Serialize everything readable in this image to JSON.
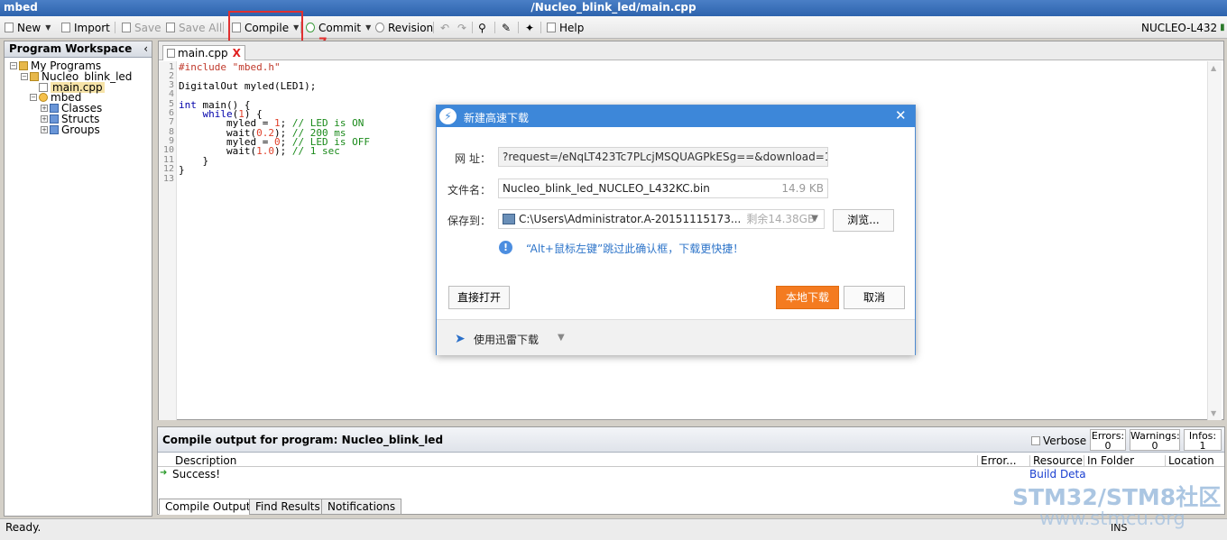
{
  "window": {
    "app_name": "mbed",
    "title": "/Nucleo_blink_led/main.cpp"
  },
  "toolbar": {
    "new": "New",
    "import": "Import",
    "save": "Save",
    "save_all": "Save All",
    "compile": "Compile",
    "commit": "Commit",
    "revision": "Revision",
    "help": "Help",
    "platform": "NUCLEO-L432",
    "annotation": "7."
  },
  "workspace": {
    "title": "Program Workspace",
    "collapse": "‹",
    "tree": {
      "my_programs": "My Programs",
      "program": "Nucleo_blink_led",
      "file": "main.cpp",
      "mbed": "mbed",
      "classes": "Classes",
      "structs": "Structs",
      "groups": "Groups"
    }
  },
  "editor": {
    "tab_label": "main.cpp",
    "tab_close": "X",
    "line_numbers": [
      "1",
      "2",
      "3",
      "4",
      "5",
      "6",
      "7",
      "8",
      "9",
      "10",
      "11",
      "12",
      "13"
    ]
  },
  "output": {
    "title": "Compile output for program: Nucleo_blink_led",
    "verbose": "Verbose",
    "errors_label": "Errors:",
    "errors": "0",
    "warnings_label": "Warnings:",
    "warnings": "0",
    "infos_label": "Infos:",
    "infos": "1",
    "columns": [
      "Description",
      "Error...",
      "Resource",
      "In Folder",
      "Location"
    ],
    "row": {
      "description": "Success!",
      "resource": "Build Deta"
    },
    "tabs": [
      "Compile Output",
      "Find Results",
      "Notifications"
    ]
  },
  "status": {
    "text": "Ready.",
    "ins": "INS"
  },
  "watermark": {
    "line1": "STM32/STM8社区",
    "line2": "www.stmcu.org"
  },
  "dialog": {
    "title": "新建高速下载",
    "close": "✕",
    "url_label": "网 址：",
    "url_value": "?request=/eNqLT423Tc7PLcjMSQUAGPkESg==&download=1",
    "filename_label": "文件名：",
    "filename_value": "Nucleo_blink_led_NUCLEO_L432KC.bin",
    "file_size": "14.9 KB",
    "saveto_label": "保存到：",
    "saveto_value": "C:\\Users\\Administrator.A-20151115173...",
    "free_space": "剩余14.38GB",
    "browse": "浏览...",
    "tip": "“Alt+鼠标左键”跳过此确认框，下载更快捷！",
    "open_direct": "直接打开",
    "local_download": "本地下载",
    "cancel": "取消",
    "use_xunlei": "使用迅雷下载"
  }
}
